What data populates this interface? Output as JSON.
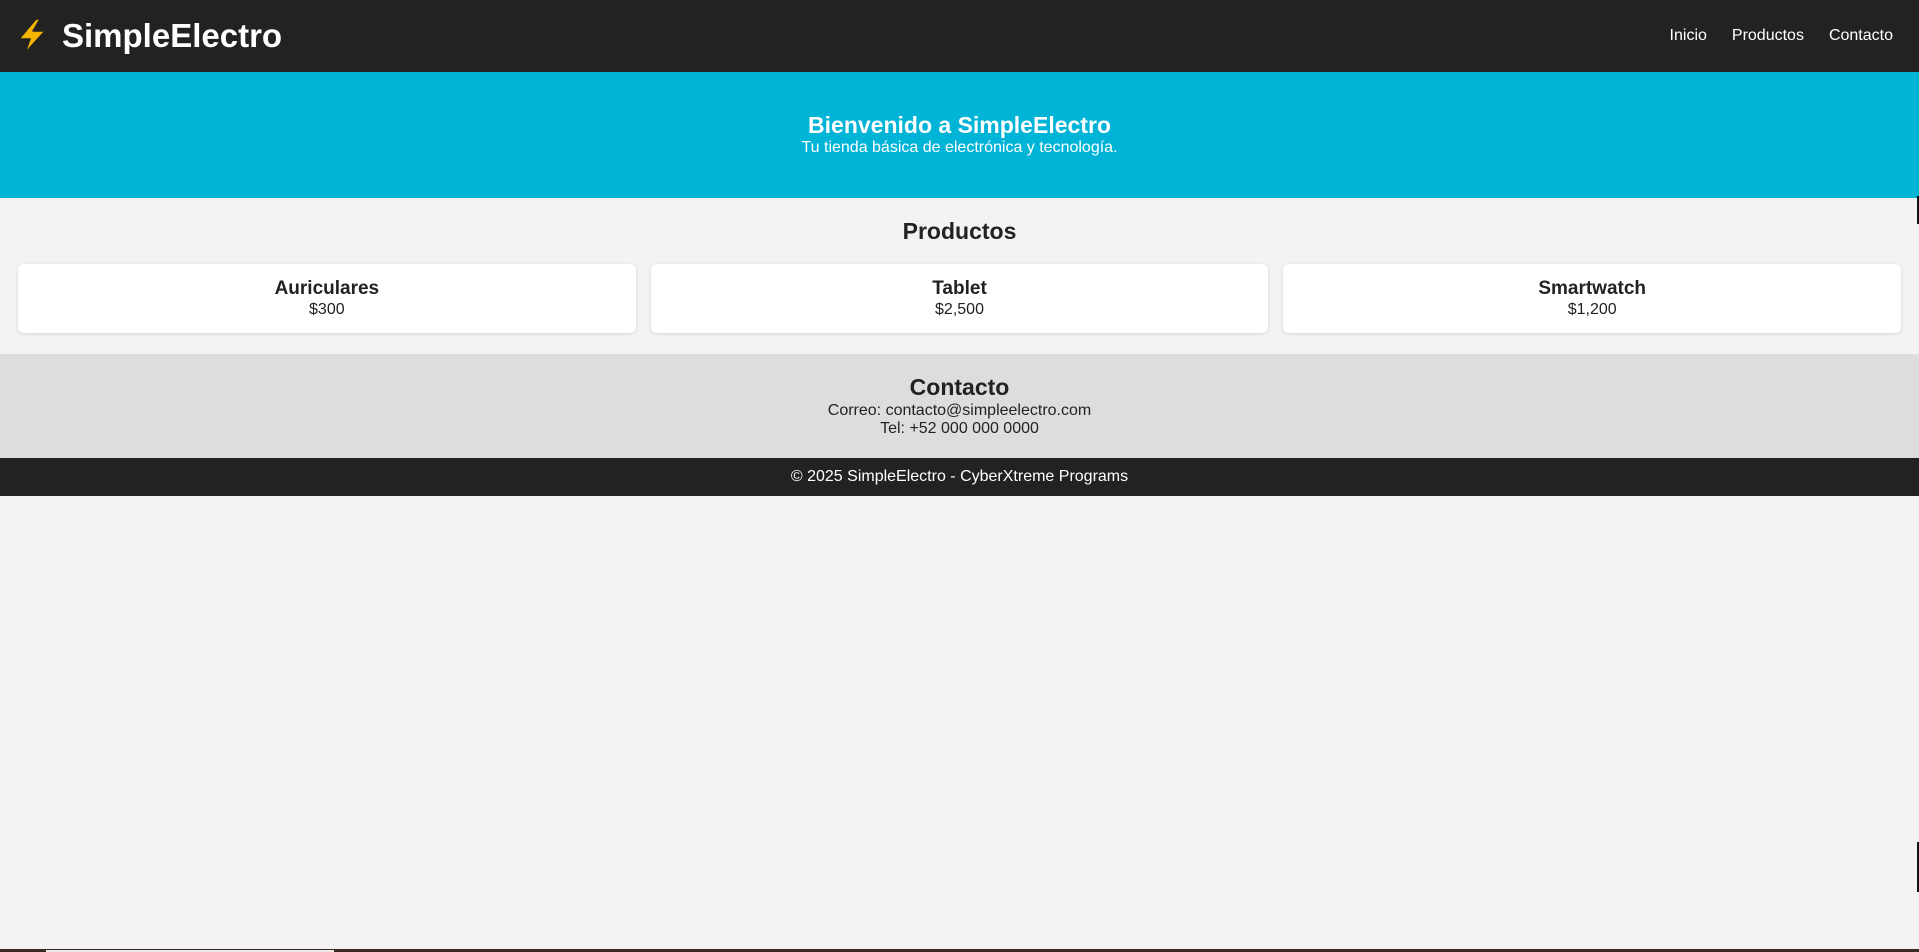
{
  "header": {
    "brand_icon": "lightning-bolt-icon",
    "brand_name": "SimpleElectro",
    "nav": [
      {
        "label": "Inicio"
      },
      {
        "label": "Productos"
      },
      {
        "label": "Contacto"
      }
    ]
  },
  "hero": {
    "title": "Bienvenido a SimpleElectro",
    "subtitle": "Tu tienda básica de electrónica y tecnología."
  },
  "products": {
    "title": "Productos",
    "items": [
      {
        "name": "Auriculares",
        "price": "$300"
      },
      {
        "name": "Tablet",
        "price": "$2,500"
      },
      {
        "name": "Smartwatch",
        "price": "$1,200"
      }
    ]
  },
  "contact": {
    "title": "Contacto",
    "email_line": "Correo: contacto@simpleelectro.com",
    "phone_line": "Tel: +52 000 000 0000"
  },
  "footer": {
    "text": "© 2025 SimpleElectro - CyberXtreme Programs"
  },
  "colors": {
    "header_bg": "#222222",
    "hero_bg": "#00b4d8",
    "page_bg": "#f3f3f3",
    "contact_bg": "#dddddd",
    "bolt": "#f4b400"
  }
}
